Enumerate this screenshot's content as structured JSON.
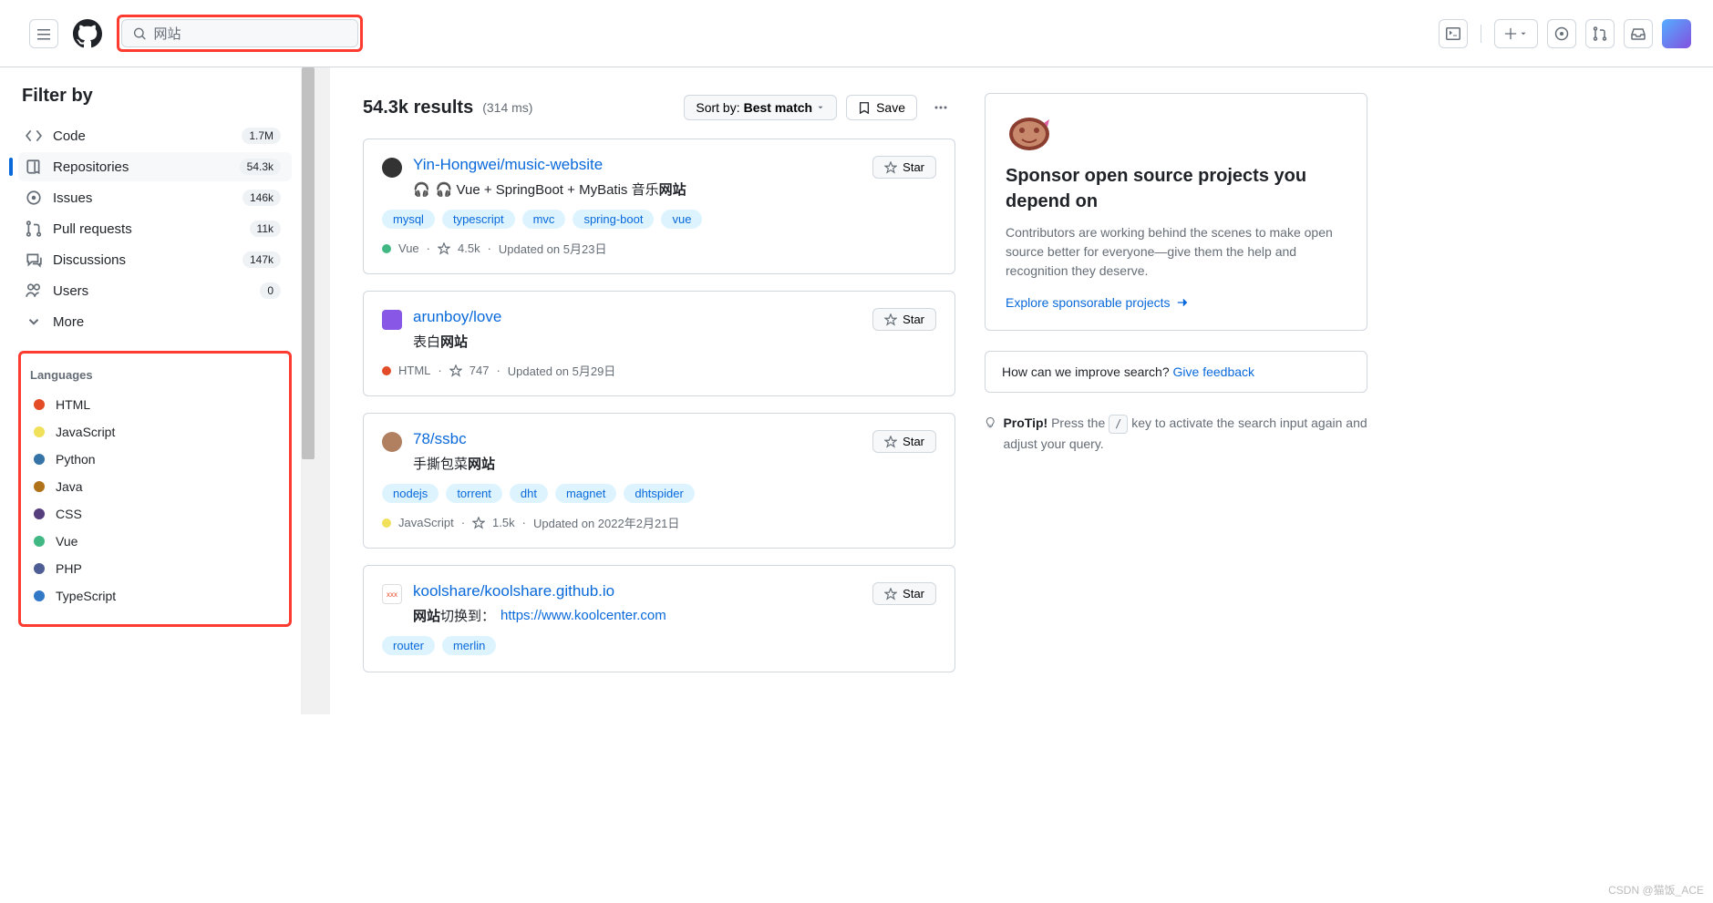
{
  "header": {
    "search_value": "网站",
    "create_tooltip": "Create",
    "issues_tooltip": "Issues",
    "pr_tooltip": "Pull requests",
    "inbox_tooltip": "Inbox"
  },
  "sidebar": {
    "title": "Filter by",
    "items": [
      {
        "icon": "code",
        "label": "Code",
        "count": "1.7M"
      },
      {
        "icon": "repo",
        "label": "Repositories",
        "count": "54.3k",
        "active": true
      },
      {
        "icon": "issue",
        "label": "Issues",
        "count": "146k"
      },
      {
        "icon": "pr",
        "label": "Pull requests",
        "count": "11k"
      },
      {
        "icon": "discussion",
        "label": "Discussions",
        "count": "147k"
      },
      {
        "icon": "people",
        "label": "Users",
        "count": "0"
      },
      {
        "icon": "chevron",
        "label": "More",
        "count": ""
      }
    ],
    "lang_title": "Languages",
    "languages": [
      {
        "name": "HTML",
        "color": "#e34c26"
      },
      {
        "name": "JavaScript",
        "color": "#f1e05a"
      },
      {
        "name": "Python",
        "color": "#3572A5"
      },
      {
        "name": "Java",
        "color": "#b07219"
      },
      {
        "name": "CSS",
        "color": "#563d7c"
      },
      {
        "name": "Vue",
        "color": "#41b883"
      },
      {
        "name": "PHP",
        "color": "#4F5D95"
      },
      {
        "name": "TypeScript",
        "color": "#3178c6"
      }
    ]
  },
  "results": {
    "count_text": "54.3k results",
    "time_text": "(314 ms)",
    "sort_prefix": "Sort by: ",
    "sort_value": "Best match",
    "save_label": "Save",
    "star_label": "Star",
    "repos": [
      {
        "avatar_bg": "#333",
        "avatar_shape": "round",
        "name": "Yin-Hongwei/music-website",
        "desc_prefix": "🎧 Vue + SpringBoot + MyBatis 音乐",
        "desc_bold": "网站",
        "desc_suffix": "",
        "topics": [
          "mysql",
          "typescript",
          "mvc",
          "spring-boot",
          "vue"
        ],
        "lang": "Vue",
        "lang_color": "#41b883",
        "stars": "4.5k",
        "updated": "Updated on 5月23日"
      },
      {
        "avatar_bg": "#8957e5",
        "avatar_shape": "sq",
        "name": "arunboy/love",
        "desc_prefix": "表白",
        "desc_bold": "网站",
        "desc_suffix": "",
        "topics": [],
        "lang": "HTML",
        "lang_color": "#e34c26",
        "stars": "747",
        "updated": "Updated on 5月29日"
      },
      {
        "avatar_bg": "#b08060",
        "avatar_shape": "round",
        "name": "78/ssbc",
        "desc_prefix": "手撕包菜",
        "desc_bold": "网站",
        "desc_suffix": "",
        "topics": [
          "nodejs",
          "torrent",
          "dht",
          "magnet",
          "dhtspider"
        ],
        "lang": "JavaScript",
        "lang_color": "#f1e05a",
        "stars": "1.5k",
        "updated": "Updated on 2022年2月21日"
      },
      {
        "avatar_bg": "#fff",
        "avatar_shape": "sq",
        "avatar_text": "xxx",
        "name": "koolshare/koolshare.github.io",
        "desc_prefix": "",
        "desc_bold": "网站",
        "desc_suffix": "切换到：",
        "desc_link": "https://www.koolcenter.com",
        "topics": [
          "router",
          "merlin"
        ],
        "lang": "",
        "lang_color": "",
        "stars": "",
        "updated": ""
      }
    ]
  },
  "sponsor": {
    "title": "Sponsor open source projects you depend on",
    "desc": "Contributors are working behind the scenes to make open source better for everyone—give them the help and recognition they deserve.",
    "link": "Explore sponsorable projects"
  },
  "feedback": {
    "text": "How can we improve search? ",
    "link": "Give feedback"
  },
  "protip": {
    "label": "ProTip!",
    "before": " Press the ",
    "key": "/",
    "after": " key to activate the search input again and adjust your query."
  },
  "watermark": "CSDN @猫饭_ACE"
}
